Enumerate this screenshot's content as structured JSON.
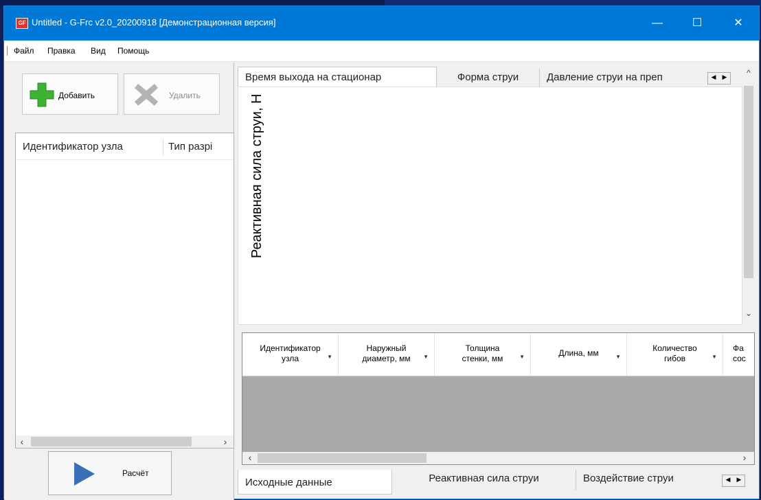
{
  "window": {
    "icon_text": "GF",
    "title": "Untitled - G-Frc v2.0_20200918  [Демонстрационная версия]",
    "controls": {
      "minimize": "—",
      "maximize": "☐",
      "close": "✕"
    }
  },
  "menu": [
    "Файл",
    "Правка",
    "Вид",
    "Помощь"
  ],
  "left_panel": {
    "add_label": "Добавить",
    "delete_label": "Удалить",
    "columns": [
      "Идентификатор узла",
      "Тип разрі"
    ],
    "calc_label": "Расчёт"
  },
  "top_tabs": [
    "Время выхода на стационар",
    "Форма струи",
    "Давление струи на преп"
  ],
  "chart": {
    "ylabel": "Реактивная сила струи, Н"
  },
  "grid": {
    "columns": [
      {
        "line1": "Идентификатор",
        "line2": "узла"
      },
      {
        "line1": "Наружный",
        "line2": "диаметр, мм"
      },
      {
        "line1": "Толщина",
        "line2": "стенки, мм"
      },
      {
        "line1": "Длина, мм",
        "line2": ""
      },
      {
        "line1": "Количество",
        "line2": "гибов"
      },
      {
        "line1": "Фа",
        "line2": "сос"
      }
    ]
  },
  "bottom_tabs": [
    "Исходные данные",
    "Реактивная сила струи",
    "Воздействие струи"
  ],
  "colors": {
    "titlebar": "#0078d7",
    "add_icon": "#3db334",
    "delete_icon": "#b0b0b0",
    "calc_icon": "#3a6fb8"
  }
}
